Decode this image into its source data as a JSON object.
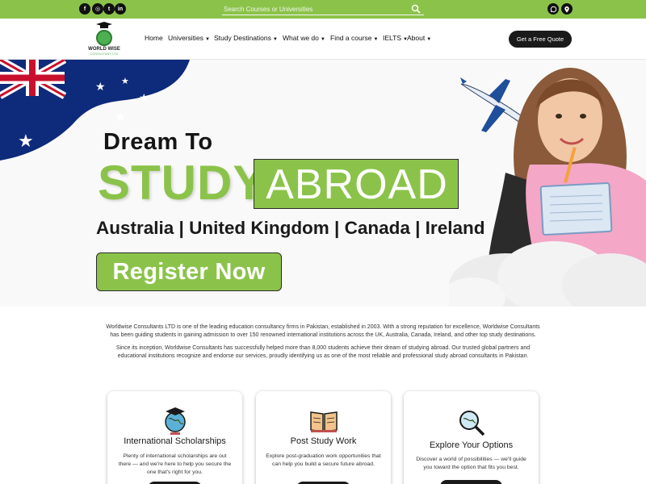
{
  "topbar": {
    "social_icons": [
      "facebook-icon",
      "instagram-icon",
      "twitter-icon",
      "linkedin-icon"
    ],
    "social_glyphs": [
      "f",
      "◎",
      "t",
      "in"
    ],
    "search_placeholder": "Search Courses or Universities",
    "contact_icons": [
      "whatsapp-icon",
      "location-pin-icon"
    ],
    "color": "#8bc34a"
  },
  "logo": {
    "title": "WORLD WISE",
    "subtitle": "CONSULTANT LTD"
  },
  "nav": {
    "home": "Home",
    "universities": "Universities",
    "study_destinations": "Study Destinations",
    "what_we_do": "What we do",
    "find_course": "Find a course",
    "ielts": "IELTS",
    "about": "About",
    "quote_button": "Get a Free Quote"
  },
  "hero": {
    "line1": "Dream To",
    "study": "STUDY",
    "abroad": "ABROAD",
    "countries": "Australia | United Kingdom | Canada | Ireland",
    "register": "Register Now",
    "accent_color": "#8bc34a"
  },
  "intro": {
    "p1": "Worldwise Consultants LTD is one of the leading education consultancy firms in Pakistan, established in 2003. With a strong reputation for excellence, Worldwise Consultants has been guiding students in gaining admission to over 150 renowned international institutions across the UK, Australia, Canada, Ireland, and other top study destinations.",
    "p2": "Since its inception, Worldwise Consultants has successfully helped more than 8,000 students achieve their dream of studying abroad. Our trusted global partners and educational institutions recognize and endorse our services, proudly identifying us as one of the most reliable and professional study abroad consultants in Pakistan."
  },
  "cards": [
    {
      "icon": "globe-graduation-icon",
      "title": "International Scholarships",
      "desc": "Plenty of international scholarships are out there — and we're here to help you secure the one that's right for you."
    },
    {
      "icon": "open-book-icon",
      "title": "Post Study Work",
      "desc": "Explore post-graduation work opportunities that can help you build a secure future abroad."
    },
    {
      "icon": "magnifier-globe-icon",
      "title": "Explore Your Options",
      "desc": "Discover a world of possibilities — we'll guide you toward the option that fits you best."
    }
  ]
}
